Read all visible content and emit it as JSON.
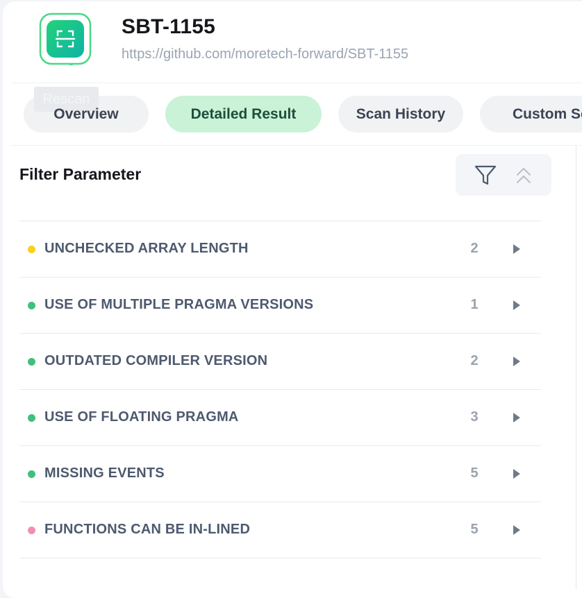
{
  "project": {
    "name": "SBT-1155",
    "url": "https://github.com/moretech-forward/SBT-1155",
    "logo_icon": "scan-frame-icon"
  },
  "actions": {
    "rescan_label": "Rescan"
  },
  "tabs": [
    {
      "label": "Overview",
      "active": false
    },
    {
      "label": "Detailed Result",
      "active": true
    },
    {
      "label": "Scan History",
      "active": false
    },
    {
      "label": "Custom Sc",
      "active": false
    }
  ],
  "filter": {
    "title": "Filter Parameter",
    "filter_icon": "funnel-icon",
    "collapse_icon": "chevron-double-up-icon"
  },
  "issues": [
    {
      "name": "UNCHECKED ARRAY LENGTH",
      "count": "2",
      "severity_color": "#f7d21b"
    },
    {
      "name": "USE OF MULTIPLE PRAGMA VERSIONS",
      "count": "1",
      "severity_color": "#3fc07c"
    },
    {
      "name": "OUTDATED COMPILER VERSION",
      "count": "2",
      "severity_color": "#3fc07c"
    },
    {
      "name": "USE OF FLOATING PRAGMA",
      "count": "3",
      "severity_color": "#3fc07c"
    },
    {
      "name": "MISSING EVENTS",
      "count": "5",
      "severity_color": "#3fc07c"
    },
    {
      "name": "FUNCTIONS CAN BE IN-LINED",
      "count": "5",
      "severity_color": "#f18fb0"
    }
  ],
  "colors": {
    "accent_green": "#3fc07c",
    "active_tab_bg": "#c9f2d7"
  }
}
